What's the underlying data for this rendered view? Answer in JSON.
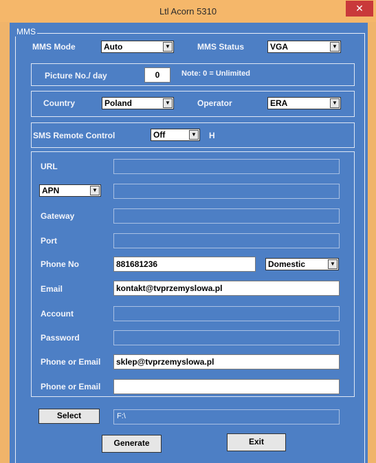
{
  "window": {
    "title": "Ltl Acorn 5310",
    "close_glyph": "✕"
  },
  "mms_group": {
    "legend": "MMS"
  },
  "mode_row": {
    "mms_mode_label": "MMS Mode",
    "mms_mode_value": "Auto",
    "mms_status_label": "MMS Status",
    "mms_status_value": "VGA"
  },
  "picture_row": {
    "label": "Picture No./ day",
    "value": "0",
    "note": "Note: 0 = Unlimited"
  },
  "country_row": {
    "country_label": "Country",
    "country_value": "Poland",
    "operator_label": "Operator",
    "operator_value": "ERA"
  },
  "sms_row": {
    "label": "SMS Remote Control",
    "value": "Off",
    "suffix": "H"
  },
  "fields": {
    "url_label": "URL",
    "url_value": "",
    "apn_value": "APN",
    "apn_field": "",
    "gateway_label": "Gateway",
    "gateway_value": "",
    "port_label": "Port",
    "port_value": "",
    "phone_label": "Phone No",
    "phone_value": "881681236",
    "phone_type": "Domestic",
    "email_label": "Email",
    "email_value": "kontakt@tvprzemyslowa.pl",
    "account_label": "Account",
    "account_value": "",
    "password_label": "Password",
    "password_value": "",
    "phone_or_email_1_label": "Phone or Email",
    "phone_or_email_1_value": "sklep@tvprzemyslowa.pl",
    "phone_or_email_2_label": "Phone or Email",
    "phone_or_email_2_value": ""
  },
  "select_row": {
    "button": "Select",
    "path": "F:\\"
  },
  "actions": {
    "generate": "Generate",
    "exit": "Exit"
  },
  "icons": {
    "dropdown": "arrow-down-icon",
    "close": "close-icon"
  }
}
